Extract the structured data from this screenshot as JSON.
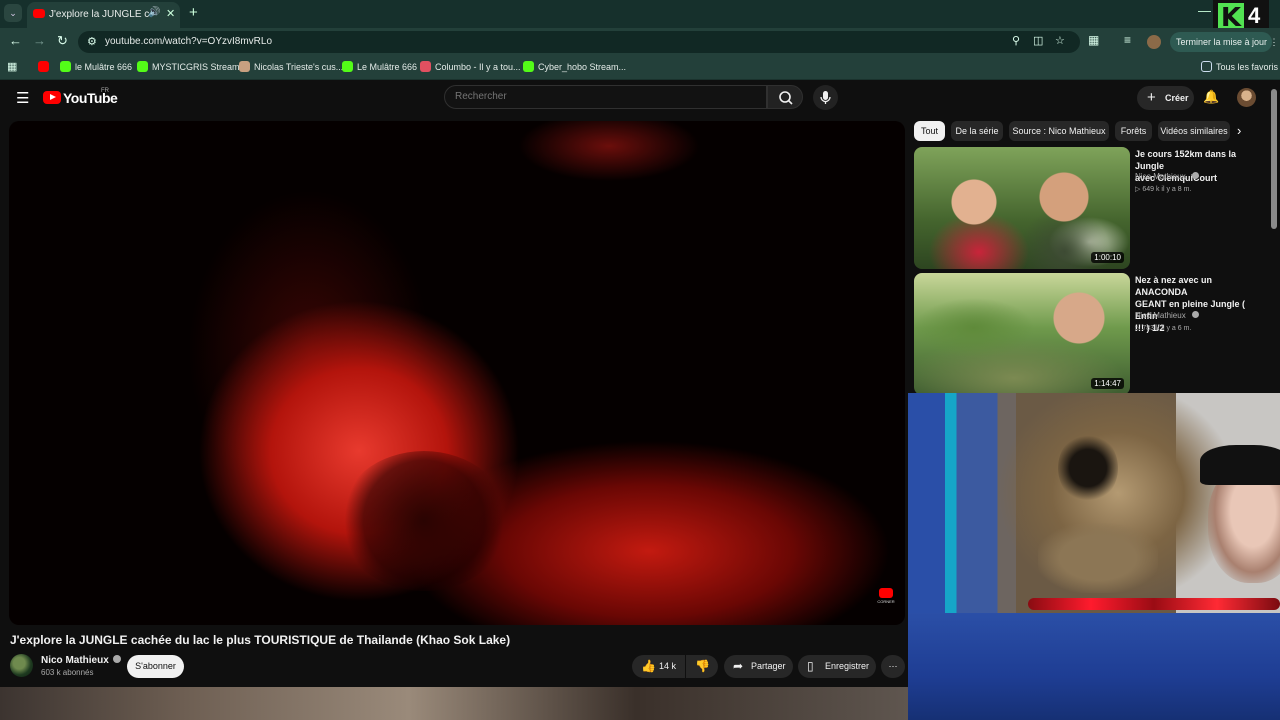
{
  "browser": {
    "tab_title": "J'explore la JUNGLE cachée du lac le plus TOURISTIQUE de Thailande",
    "url": "youtube.com/watch?v=OYzvI8mvRLo",
    "update_label": "Terminer la mise à jour",
    "bookmarks": [
      {
        "label": "",
        "color": "#ff0000"
      },
      {
        "label": "le Mulâtre 666",
        "color": "#53fc18"
      },
      {
        "label": "MYSTICGRIS Stream...",
        "color": "#53fc18"
      },
      {
        "label": "Nicolas Trieste's cus...",
        "color": "#c8a080"
      },
      {
        "label": "Le Mulâtre 666",
        "color": "#53fc18"
      },
      {
        "label": "Columbo - Il y a tou...",
        "color": "#e05060"
      },
      {
        "label": "Cyber_hobo Stream...",
        "color": "#53fc18"
      }
    ],
    "all_bookmarks_label": "Tous les favoris"
  },
  "overlay_logo": {
    "letter": "K",
    "number": "4"
  },
  "youtube": {
    "logo_text": "YouTube",
    "region": "FR",
    "search_placeholder": "Rechercher",
    "create_label": "Créer"
  },
  "video": {
    "title": "J'explore la JUNGLE cachée du lac le plus TOURISTIQUE de Thailande (Khao Sok Lake)",
    "channel": "Nico Mathieux",
    "subscribers": "603 k abonnés",
    "subscribe_label": "S'abonner",
    "likes": "14 k",
    "share_label": "Partager",
    "save_label": "Enregistrer",
    "watermark_label": "CORNER"
  },
  "chips": [
    "Tout",
    "De la série",
    "Source : Nico Mathieux",
    "Forêts",
    "Vidéos similaires"
  ],
  "related": [
    {
      "title_line1": "Je cours 152km dans la Jungle",
      "title_line2": "avec ClemquiCourt",
      "title_line3": "",
      "channel": "Nico Mathieux",
      "meta": "649 k  il y a 8 m.",
      "duration": "1:00:10"
    },
    {
      "title_line1": "Nez à nez avec un ANACONDA",
      "title_line2": "GEANT en pleine Jungle ( Enfin",
      "title_line3": "!!! ) 1/2",
      "channel": "Nico Mathieux",
      "meta": "783 k  il y a 6 m.",
      "duration": "1:14:47"
    }
  ]
}
